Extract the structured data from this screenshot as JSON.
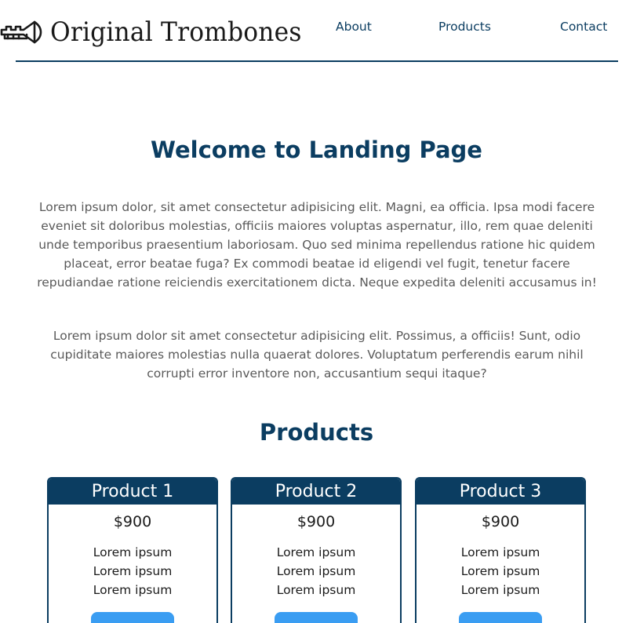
{
  "header": {
    "logo_text": "Original Trombones",
    "nav": [
      "About",
      "Products",
      "Contact"
    ]
  },
  "hero": {
    "title": "Welcome to Landing Page",
    "paragraphs": [
      "Lorem ipsum dolor, sit amet consectetur adipisicing elit. Magni, ea officia. Ipsa modi facere eveniet sit doloribus molestias, officiis maiores voluptas aspernatur, illo, rem quae deleniti unde temporibus praesentium laboriosam. Quo sed minima repellendus ratione hic quidem placeat, error beatae fuga? Ex commodi beatae id eligendi vel fugit, tenetur facere repudiandae ratione reiciendis exercitationem dicta. Neque expedita deleniti accusamus in!",
      "Lorem ipsum dolor sit amet consectetur adipisicing elit. Possimus, a officiis! Sunt, odio cupiditate maiores molestias nulla quaerat dolores. Voluptatum perferendis earum nihil corrupti error inventore non, accusantium sequi itaque?"
    ]
  },
  "products": {
    "title": "Products",
    "items": [
      {
        "name": "Product 1",
        "price": "$900",
        "features": [
          "Lorem ipsum",
          "Lorem ipsum",
          "Lorem ipsum"
        ]
      },
      {
        "name": "Product 2",
        "price": "$900",
        "features": [
          "Lorem ipsum",
          "Lorem ipsum",
          "Lorem ipsum"
        ]
      },
      {
        "name": "Product 3",
        "price": "$900",
        "features": [
          "Lorem ipsum",
          "Lorem ipsum",
          "Lorem ipsum"
        ]
      }
    ]
  },
  "colors": {
    "primary": "#0b3d61",
    "button": "#3a9df2",
    "text_muted": "#595959"
  },
  "icons": {
    "logo": "trumpet-icon"
  }
}
